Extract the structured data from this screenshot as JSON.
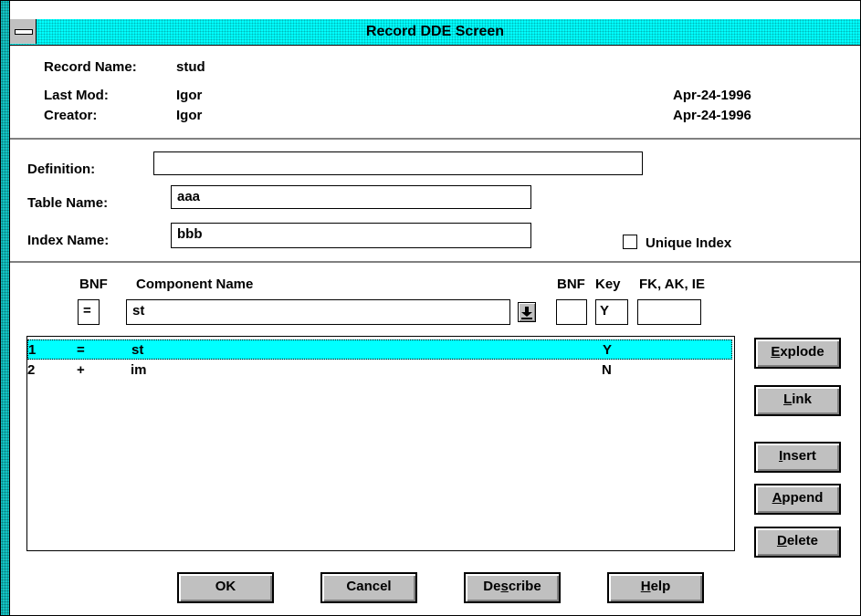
{
  "window": {
    "title": "Record DDE Screen"
  },
  "header": {
    "record_name_label": "Record Name:",
    "record_name_value": "stud",
    "last_mod_label": "Last Mod:",
    "last_mod_user": "Igor",
    "last_mod_date": "Apr-24-1996",
    "creator_label": "Creator:",
    "creator_user": "Igor",
    "creator_date": "Apr-24-1996"
  },
  "form": {
    "definition_label": "Definition:",
    "definition_value": "",
    "table_name_label": "Table Name:",
    "table_name_value": "aaa",
    "index_name_label": "Index Name:",
    "index_name_value": "bbb",
    "unique_index_label": "Unique Index"
  },
  "component_editor": {
    "bnf_header": "BNF",
    "component_name_header": "Component Name",
    "bnf2_header": "BNF",
    "key_header": "Key",
    "fk_header": "FK, AK, IE",
    "bnf_value": "=",
    "component_value": "st",
    "bnf2_value": "",
    "key_value": "Y",
    "fk_value": ""
  },
  "components": [
    {
      "num": "1",
      "bnf": "=",
      "name": "st",
      "key": "Y"
    },
    {
      "num": "2",
      "bnf": "+",
      "name": "im",
      "key": "N"
    }
  ],
  "side_buttons": {
    "explode": {
      "pre": "",
      "u": "E",
      "post": "xplode"
    },
    "link": {
      "pre": "",
      "u": "L",
      "post": "ink"
    },
    "insert": {
      "pre": "",
      "u": "I",
      "post": "nsert"
    },
    "append": {
      "pre": "",
      "u": "A",
      "post": "ppend"
    },
    "delete": {
      "pre": "",
      "u": "D",
      "post": "elete"
    }
  },
  "bottom_buttons": {
    "ok": "OK",
    "cancel": "Cancel",
    "describe": {
      "pre": "De",
      "u": "s",
      "post": "cribe"
    },
    "help": {
      "pre": "",
      "u": "H",
      "post": "elp"
    }
  },
  "colors": {
    "titlebar": "#00ffff",
    "selection": "#00ffff",
    "button_face": "#c0c0c0"
  },
  "icons": {
    "system_menu": "system-menu-icon",
    "dropdown": "arrow-down-icon"
  }
}
